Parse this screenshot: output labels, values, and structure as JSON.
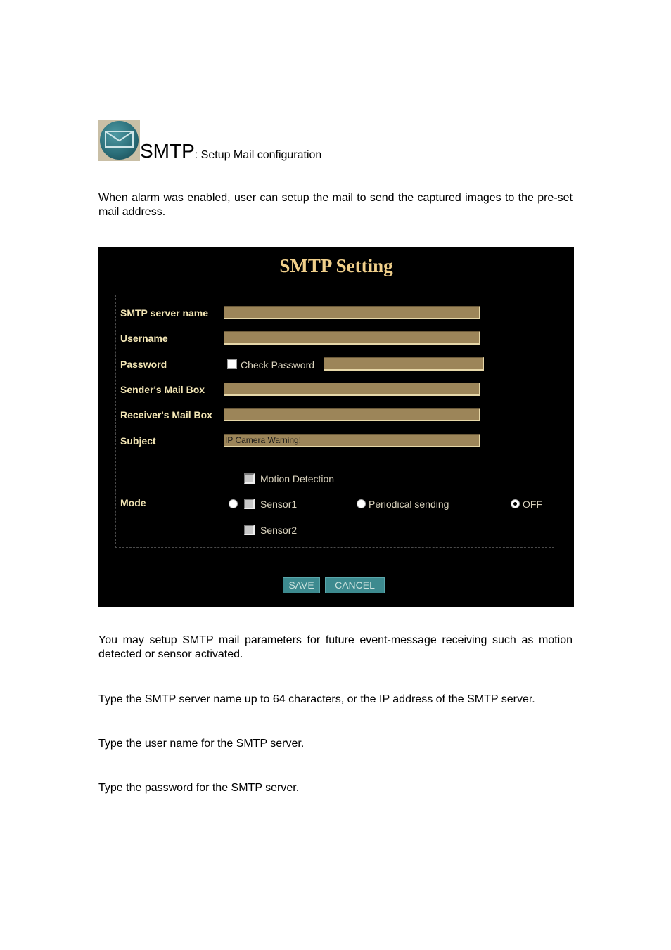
{
  "heading": {
    "icon": "mail-envelope-icon",
    "title": "SMTP",
    "subtitle": ": Setup Mail configuration"
  },
  "intro": "When alarm was enabled, user can setup the mail to send the captured images to the pre-set mail address.",
  "panel": {
    "title": "SMTP Setting",
    "fields": {
      "server_label": "SMTP server name",
      "server_value": "",
      "username_label": "Username",
      "username_value": "",
      "password_label": "Password",
      "check_password_label": "Check Password",
      "check_password_checked": false,
      "password_value": "",
      "sender_label": "Sender's Mail Box",
      "sender_value": "",
      "receiver_label": "Receiver's Mail Box",
      "receiver_value": "",
      "subject_label": "Subject",
      "subject_value": "IP Camera Warning!"
    },
    "mode": {
      "label": "Mode",
      "checkbox_options": [
        "Motion Detection",
        "Sensor1",
        "Sensor2"
      ],
      "radio_periodical": "Periodical sending",
      "radio_off": "OFF",
      "selected": "OFF"
    },
    "buttons": {
      "save": "SAVE",
      "cancel": "CANCEL"
    }
  },
  "paragraphs": [
    "You may setup SMTP mail parameters for future event-message receiving such as motion detected or sensor activated.",
    "Type the SMTP server name up to 64 characters, or the IP address of the SMTP server.",
    "Type the user name for the SMTP server.",
    "Type the password for the SMTP server."
  ]
}
